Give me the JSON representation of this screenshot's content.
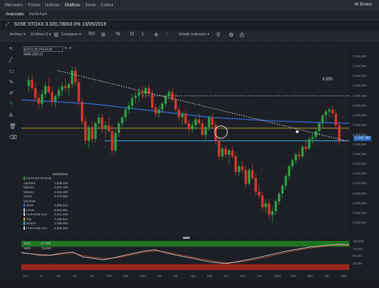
{
  "topnav": {
    "items": [
      "Mercados",
      "Fichas",
      "Noticias",
      "Gráficos",
      "Socar",
      "Cotera"
    ],
    "active": 3,
    "brand": "Mi Broker"
  },
  "subtabs": {
    "items": [
      "Avanzado",
      "Multichart"
    ],
    "active": 0
  },
  "title": "SX5E STOXX 3.320,78003 0% 13/05/2019",
  "toolbar": {
    "archivo": "Archivo ▾",
    "period": "10 Años D ▾",
    "comparar": "Comparar ▾",
    "anadir": "Añadir indicador ▾",
    "d_label": "D",
    "l_label": "L"
  },
  "legend": {
    "line1": "ESTX 50 PR.EUR",
    "line2": "SMA (200,0)"
  },
  "datatable": {
    "date": "22/02/2019",
    "rows": [
      {
        "k": "ESTX 50 PR.EUR",
        "v": "",
        "c": "#2ea043"
      },
      {
        "k": "Apertura",
        "v": "3.239,100",
        "c": ""
      },
      {
        "k": "Máximo",
        "v": "3.281,780",
        "c": ""
      },
      {
        "k": "Mínimo",
        "v": "3.223,400",
        "c": ""
      },
      {
        "k": "Cierre",
        "v": "3.270,550",
        "c": ""
      },
      {
        "k": "Volumen",
        "v": "",
        "c": ""
      },
      {
        "k": "Mm5",
        "v": "3.305,644",
        "c": "#2f6bd8"
      },
      {
        "k": "Línea",
        "v": "3.381,651",
        "c": "#cfd3d8"
      },
      {
        "k": "Horizontal Line",
        "v": "3.541,248",
        "c": "#d7d2e6"
      },
      {
        "k": "Top",
        "v": "3.299,611",
        "c": "#c8a83a"
      },
      {
        "k": "Bottom",
        "v": "3.296,654",
        "c": "#3fb6e6"
      },
      {
        "k": "Horizontal Line",
        "v": "3.386,252",
        "c": "#cfd3d8"
      }
    ]
  },
  "annotation_3550": "3.550",
  "last_price_tag": "3.320,780",
  "y_axis_ticks": [
    "3.750,000",
    "3.700,000",
    "3.650,000",
    "3.600,000",
    "3.550,000",
    "3.500,000",
    "3.450,000",
    "3.400,000",
    "3.350,000",
    "3.300,000",
    "3.250,000",
    "3.200,000",
    "3.150,000",
    "3.100,000",
    "3.050,000",
    "3.000,000",
    "2.950,000",
    "2.900,000"
  ],
  "oscillator": {
    "k_label": "%KS",
    "k_value": "87.335",
    "d_label": "%DS",
    "d_value": "79.263",
    "y_ticks": [
      "100,000",
      "75,000",
      "50,000",
      "25,000"
    ]
  },
  "x_axis_labels": [
    "Oct",
    "17",
    "Dic",
    "22",
    "18",
    "Feb",
    "Mar",
    "May",
    "Jun",
    "Jul",
    "Ago",
    "Sep",
    "Oct",
    "Nov",
    "Dic",
    "2019",
    "Feb",
    "Mar",
    "Abr",
    "May"
  ],
  "colors": {
    "up": "#2ea043",
    "down": "#d8382b",
    "bg": "#1c1f25",
    "sma": "#2f6bd8",
    "hline_cyan": "#3fb6e6",
    "hline_yellow": "#c8a83a",
    "trend": "#e6e6e6"
  },
  "chart_data": {
    "type": "candlestick",
    "title": "SX5E STOXX",
    "ylim": [
      2850,
      3800
    ],
    "candles": [
      [
        3600,
        3650,
        3570,
        3630
      ],
      [
        3630,
        3660,
        3580,
        3590
      ],
      [
        3590,
        3620,
        3520,
        3540
      ],
      [
        3540,
        3570,
        3480,
        3510
      ],
      [
        3510,
        3580,
        3490,
        3560
      ],
      [
        3560,
        3620,
        3540,
        3600
      ],
      [
        3600,
        3640,
        3560,
        3570
      ],
      [
        3570,
        3600,
        3500,
        3520
      ],
      [
        3520,
        3560,
        3490,
        3550
      ],
      [
        3550,
        3600,
        3530,
        3580
      ],
      [
        3580,
        3620,
        3550,
        3600
      ],
      [
        3600,
        3640,
        3570,
        3590
      ],
      [
        3590,
        3620,
        3550,
        3610
      ],
      [
        3610,
        3700,
        3590,
        3680
      ],
      [
        3680,
        3700,
        3600,
        3620
      ],
      [
        3620,
        3640,
        3500,
        3520
      ],
      [
        3520,
        3540,
        3400,
        3420
      ],
      [
        3420,
        3450,
        3300,
        3320
      ],
      [
        3320,
        3400,
        3280,
        3390
      ],
      [
        3390,
        3420,
        3310,
        3330
      ],
      [
        3330,
        3420,
        3310,
        3410
      ],
      [
        3410,
        3460,
        3380,
        3440
      ],
      [
        3440,
        3460,
        3360,
        3380
      ],
      [
        3380,
        3420,
        3340,
        3400
      ],
      [
        3400,
        3440,
        3360,
        3370
      ],
      [
        3370,
        3400,
        3250,
        3270
      ],
      [
        3270,
        3380,
        3260,
        3360
      ],
      [
        3360,
        3420,
        3340,
        3410
      ],
      [
        3410,
        3450,
        3390,
        3440
      ],
      [
        3440,
        3490,
        3420,
        3480
      ],
      [
        3480,
        3520,
        3460,
        3500
      ],
      [
        3500,
        3560,
        3480,
        3540
      ],
      [
        3540,
        3570,
        3510,
        3550
      ],
      [
        3550,
        3590,
        3520,
        3570
      ],
      [
        3570,
        3600,
        3530,
        3560
      ],
      [
        3560,
        3600,
        3540,
        3590
      ],
      [
        3590,
        3610,
        3550,
        3560
      ],
      [
        3560,
        3580,
        3480,
        3490
      ],
      [
        3490,
        3510,
        3440,
        3460
      ],
      [
        3460,
        3500,
        3440,
        3480
      ],
      [
        3480,
        3520,
        3460,
        3510
      ],
      [
        3510,
        3560,
        3490,
        3550
      ],
      [
        3550,
        3580,
        3530,
        3570
      ],
      [
        3570,
        3590,
        3520,
        3530
      ],
      [
        3530,
        3560,
        3470,
        3480
      ],
      [
        3480,
        3500,
        3420,
        3440
      ],
      [
        3440,
        3470,
        3400,
        3460
      ],
      [
        3460,
        3480,
        3400,
        3410
      ],
      [
        3410,
        3430,
        3360,
        3380
      ],
      [
        3380,
        3420,
        3360,
        3400
      ],
      [
        3400,
        3440,
        3380,
        3430
      ],
      [
        3430,
        3460,
        3400,
        3410
      ],
      [
        3410,
        3430,
        3340,
        3350
      ],
      [
        3350,
        3400,
        3330,
        3390
      ],
      [
        3390,
        3450,
        3370,
        3440
      ],
      [
        3440,
        3460,
        3380,
        3400
      ],
      [
        3400,
        3420,
        3300,
        3320
      ],
      [
        3320,
        3340,
        3220,
        3240
      ],
      [
        3240,
        3290,
        3220,
        3280
      ],
      [
        3280,
        3300,
        3230,
        3250
      ],
      [
        3250,
        3280,
        3200,
        3270
      ],
      [
        3270,
        3290,
        3230,
        3240
      ],
      [
        3240,
        3260,
        3140,
        3160
      ],
      [
        3160,
        3200,
        3140,
        3190
      ],
      [
        3190,
        3220,
        3150,
        3170
      ],
      [
        3170,
        3190,
        3080,
        3100
      ],
      [
        3100,
        3180,
        3090,
        3170
      ],
      [
        3170,
        3200,
        3120,
        3130
      ],
      [
        3130,
        3160,
        3040,
        3060
      ],
      [
        3060,
        3100,
        3020,
        3040
      ],
      [
        3040,
        3060,
        2960,
        2980
      ],
      [
        2980,
        3020,
        2950,
        3000
      ],
      [
        3000,
        3020,
        2920,
        2940
      ],
      [
        2940,
        2980,
        2900,
        2960
      ],
      [
        2960,
        3020,
        2940,
        3010
      ],
      [
        3010,
        3060,
        2990,
        3050
      ],
      [
        3050,
        3100,
        3030,
        3090
      ],
      [
        3090,
        3150,
        3070,
        3140
      ],
      [
        3140,
        3200,
        3120,
        3190
      ],
      [
        3190,
        3230,
        3170,
        3220
      ],
      [
        3220,
        3260,
        3200,
        3250
      ],
      [
        3250,
        3280,
        3220,
        3240
      ],
      [
        3240,
        3300,
        3230,
        3290
      ],
      [
        3290,
        3320,
        3260,
        3280
      ],
      [
        3280,
        3340,
        3270,
        3330
      ],
      [
        3330,
        3360,
        3300,
        3340
      ],
      [
        3340,
        3380,
        3320,
        3370
      ],
      [
        3370,
        3420,
        3350,
        3410
      ],
      [
        3410,
        3460,
        3390,
        3450
      ],
      [
        3450,
        3480,
        3420,
        3470
      ],
      [
        3470,
        3490,
        3440,
        3480
      ],
      [
        3480,
        3500,
        3440,
        3460
      ],
      [
        3460,
        3480,
        3380,
        3400
      ],
      [
        3400,
        3420,
        3300,
        3320
      ]
    ],
    "sma200": [
      3530,
      3525,
      3520,
      3515,
      3510,
      3500,
      3490,
      3480,
      3470,
      3460,
      3450,
      3440,
      3435,
      3430,
      3425,
      3420,
      3418,
      3415,
      3412,
      3410
    ],
    "horizontal_lines": [
      3550,
      3385,
      3320
    ],
    "trendline": {
      "from": [
        3680,
        0.11
      ],
      "to": [
        3320,
        0.99
      ]
    },
    "oscillator_k": [
      60,
      55,
      50,
      52,
      58,
      62,
      45,
      40,
      35,
      42,
      50,
      58,
      65,
      70,
      60,
      52,
      45,
      38,
      30,
      25,
      22,
      28,
      35,
      42,
      50,
      58,
      66,
      72,
      78,
      82,
      86,
      88,
      87
    ],
    "oscillator_d": [
      58,
      56,
      53,
      51,
      55,
      58,
      50,
      44,
      40,
      41,
      47,
      54,
      61,
      66,
      63,
      56,
      49,
      42,
      35,
      29,
      25,
      26,
      31,
      38,
      45,
      53,
      61,
      68,
      74,
      79,
      83,
      86,
      85
    ]
  }
}
